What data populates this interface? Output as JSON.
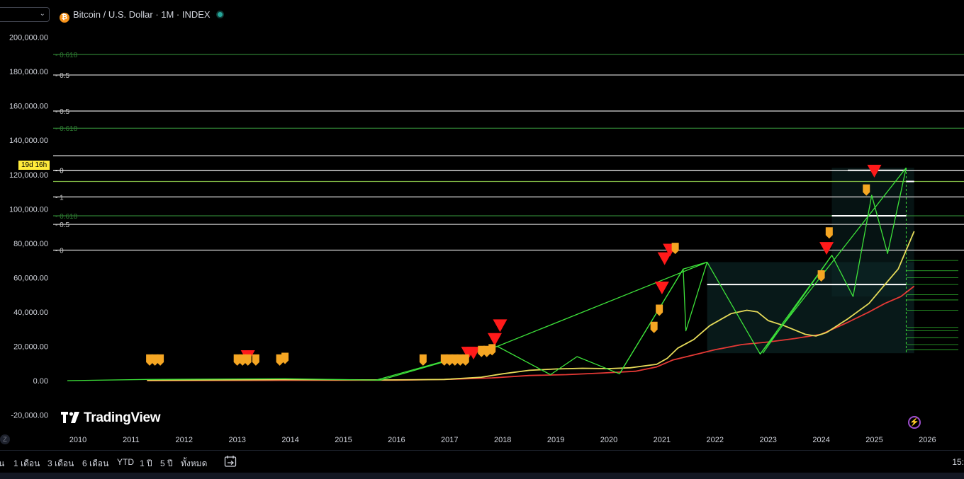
{
  "header": {
    "title": "Bitcoin / U.S. Dollar · 1M · INDEX",
    "btc_glyph": "₿"
  },
  "countdown": "19d 16h",
  "logo": {
    "text": "TradingView"
  },
  "bottom": {
    "ranges": [
      "ัน",
      "1 เดือน",
      "3 เดือน",
      "6 เดือน",
      "YTD",
      "1 ปี",
      "5 ปี",
      "ทั้งหมด"
    ],
    "clock": "15:",
    "z_label": "Z",
    "bolt_glyph": "⚡"
  },
  "colors": {
    "background": "#000000",
    "axis_text": "#d1d4dc",
    "red_ma": "#e53935",
    "yellow_ma": "#e6db59",
    "zigzag": "#3de23a",
    "fib_green": "#2e7d32",
    "fib_white": "#c8c8c8",
    "marker_orange": "#f5a623",
    "marker_red": "#ff1a1a"
  },
  "chart_data": {
    "type": "line",
    "title": "Bitcoin / U.S. Dollar · 1M · INDEX",
    "xlabel": "",
    "ylabel": "",
    "x_range": [
      2009.8,
      2026.6
    ],
    "ylim": [
      -25000,
      210000
    ],
    "x_ticks": [
      "2010",
      "2011",
      "2012",
      "2013",
      "2014",
      "2015",
      "2016",
      "2017",
      "2018",
      "2019",
      "2020",
      "2021",
      "2022",
      "2023",
      "2024",
      "2025",
      "2026"
    ],
    "y_ticks": [
      "200,000.00",
      "180,000.00",
      "160,000.00",
      "140,000.00",
      "120,000.00",
      "100,000.00",
      "80,000.00",
      "60,000.00",
      "40,000.00",
      "20,000.00",
      "0.00",
      "-20,000.00"
    ],
    "grid": false,
    "series": [
      {
        "color": "#e53935",
        "points": [
          [
            2011.3,
            0
          ],
          [
            2014.0,
            200
          ],
          [
            2016.0,
            300
          ],
          [
            2017.0,
            800
          ],
          [
            2017.8,
            1600
          ],
          [
            2018.5,
            3000
          ],
          [
            2019.2,
            3500
          ],
          [
            2019.9,
            4500
          ],
          [
            2020.5,
            5500
          ],
          [
            2020.9,
            8000
          ],
          [
            2021.2,
            12000
          ],
          [
            2021.6,
            15000
          ],
          [
            2022.0,
            18000
          ],
          [
            2022.5,
            21000
          ],
          [
            2023.0,
            22500
          ],
          [
            2023.5,
            24500
          ],
          [
            2024.0,
            27000
          ],
          [
            2024.5,
            34000
          ],
          [
            2024.9,
            40000
          ],
          [
            2025.2,
            45000
          ],
          [
            2025.5,
            49000
          ],
          [
            2025.75,
            55000
          ]
        ]
      },
      {
        "color": "#e6db59",
        "points": [
          [
            2011.3,
            200
          ],
          [
            2013.8,
            600
          ],
          [
            2015.8,
            400
          ],
          [
            2016.9,
            700
          ],
          [
            2017.6,
            2000
          ],
          [
            2018.0,
            4000
          ],
          [
            2018.5,
            6000
          ],
          [
            2019.0,
            6800
          ],
          [
            2019.5,
            7200
          ],
          [
            2020.0,
            7000
          ],
          [
            2020.4,
            7500
          ],
          [
            2020.9,
            9500
          ],
          [
            2021.1,
            13000
          ],
          [
            2021.3,
            19000
          ],
          [
            2021.6,
            24000
          ],
          [
            2021.9,
            32000
          ],
          [
            2022.3,
            39000
          ],
          [
            2022.6,
            41000
          ],
          [
            2022.8,
            40000
          ],
          [
            2023.0,
            35000
          ],
          [
            2023.3,
            32000
          ],
          [
            2023.7,
            27000
          ],
          [
            2023.9,
            26000
          ],
          [
            2024.1,
            28000
          ],
          [
            2024.5,
            36000
          ],
          [
            2024.9,
            45000
          ],
          [
            2025.2,
            56000
          ],
          [
            2025.45,
            65000
          ],
          [
            2025.75,
            87000
          ]
        ]
      },
      {
        "color": "#3de23a",
        "points": [
          [
            2009.8,
            0
          ],
          [
            2011.3,
            700
          ],
          [
            2013.9,
            1100
          ],
          [
            2015.7,
            300
          ],
          [
            2017.9,
            20000
          ],
          [
            2018.9,
            3500
          ],
          [
            2019.4,
            14000
          ],
          [
            2020.2,
            4000
          ],
          [
            2021.4,
            65000
          ],
          [
            2021.85,
            69000
          ],
          [
            2022.85,
            15500
          ],
          [
            2024.2,
            73000
          ],
          [
            2024.6,
            49000
          ],
          [
            2024.95,
            108000
          ],
          [
            2025.25,
            74000
          ],
          [
            2025.6,
            124000
          ]
        ]
      },
      {
        "color": "#3de23a",
        "points": [
          [
            2015.6,
            200
          ],
          [
            2017.9,
            20000
          ]
        ]
      },
      {
        "color": "#3de23a",
        "points": [
          [
            2017.9,
            20000
          ],
          [
            2021.85,
            69000
          ]
        ]
      },
      {
        "color": "#3de23a",
        "points": [
          [
            2020.2,
            4000
          ],
          [
            2021.4,
            65000
          ],
          [
            2021.45,
            29000
          ],
          [
            2021.85,
            69000
          ]
        ]
      },
      {
        "color": "#3de23a",
        "points": [
          [
            2022.85,
            15500
          ],
          [
            2025.6,
            124000
          ]
        ]
      },
      {
        "color": "#3de23a",
        "points": [
          [
            2022.9,
            16000
          ],
          [
            2024.2,
            73000
          ]
        ]
      }
    ],
    "horizontal_lines": [
      {
        "y": 190000,
        "color": "#2e7d32",
        "label": "0.618"
      },
      {
        "y": 178000,
        "color": "#c8c8c8",
        "label": "0.5"
      },
      {
        "y": 157000,
        "color": "#c8c8c8",
        "label": "0.5"
      },
      {
        "y": 147000,
        "color": "#2e7d32",
        "label": "0.618"
      },
      {
        "y": 131000,
        "color": "#c8c8c8",
        "label": ""
      },
      {
        "y": 122500,
        "color": "#e6e6e6",
        "label": "0"
      },
      {
        "y": 116000,
        "color": "#7cb342",
        "label": ""
      },
      {
        "y": 107000,
        "color": "#c8c8c8",
        "label": "1"
      },
      {
        "y": 96000,
        "color": "#2e7d32",
        "label": "0.618"
      },
      {
        "y": 91000,
        "color": "#c8c8c8",
        "label": "0.5"
      },
      {
        "y": 76000,
        "color": "#c8c8c8",
        "label": "0"
      }
    ],
    "zones": [
      {
        "x": [
          2021.85,
          2025.75
        ],
        "y": [
          16000,
          69000
        ]
      },
      {
        "x": [
          2024.2,
          2025.75
        ],
        "y": [
          49000,
          124000
        ]
      }
    ],
    "segments": [
      {
        "x": [
          2021.85,
          2025.6
        ],
        "y": 56000,
        "color": "#ffffff"
      },
      {
        "x": [
          2024.2,
          2025.6
        ],
        "y": 96000,
        "color": "#ffffff"
      },
      {
        "x": [
          2024.5,
          2025.6
        ],
        "y": 122500,
        "color": "#ffffff"
      },
      {
        "x": [
          2025.6,
          2025.75
        ],
        "y": 116000,
        "color": "#ffffff"
      }
    ],
    "marker_orange": [
      [
        2011.35,
        12000
      ],
      [
        2011.45,
        12000
      ],
      [
        2011.55,
        12000
      ],
      [
        2013.0,
        12000
      ],
      [
        2013.1,
        12000
      ],
      [
        2013.2,
        12000
      ],
      [
        2013.35,
        12000
      ],
      [
        2013.8,
        12000
      ],
      [
        2013.9,
        13000
      ],
      [
        2016.5,
        12000
      ],
      [
        2016.9,
        12000
      ],
      [
        2017.0,
        12000
      ],
      [
        2017.1,
        12000
      ],
      [
        2017.2,
        12000
      ],
      [
        2017.3,
        12000
      ],
      [
        2017.6,
        17000
      ],
      [
        2017.7,
        17000
      ],
      [
        2017.8,
        18000
      ],
      [
        2020.85,
        31000
      ],
      [
        2020.95,
        41000
      ],
      [
        2021.25,
        77000
      ],
      [
        2024.0,
        61000
      ],
      [
        2024.15,
        86000
      ],
      [
        2024.85,
        111000
      ]
    ],
    "marker_red": [
      [
        2013.2,
        14000
      ],
      [
        2017.35,
        16000
      ],
      [
        2017.45,
        16000
      ],
      [
        2017.85,
        24000
      ],
      [
        2017.95,
        32000
      ],
      [
        2021.0,
        54000
      ],
      [
        2021.05,
        71000
      ],
      [
        2021.15,
        76000
      ],
      [
        2024.1,
        77000
      ],
      [
        2025.0,
        122000
      ]
    ],
    "right_ladder": [
      70000,
      64000,
      60000,
      56000,
      50000,
      47000,
      41000,
      31000,
      29000,
      25000,
      21000,
      18000
    ]
  }
}
